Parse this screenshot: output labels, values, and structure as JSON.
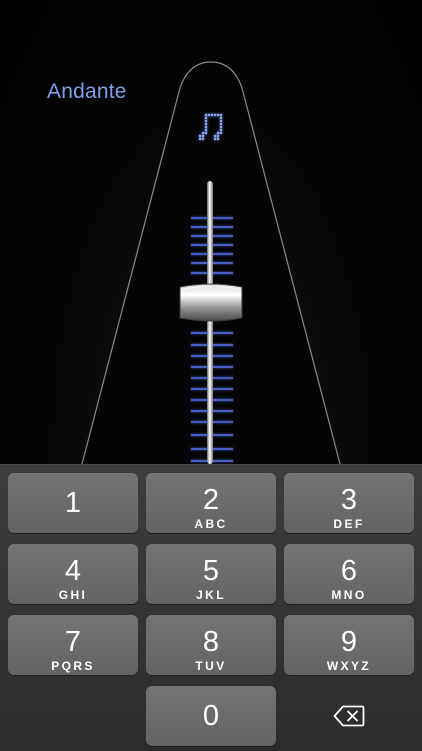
{
  "tempo": {
    "marking": "Andante"
  },
  "colors": {
    "accent_blue": "#7c9fe8",
    "led_blue": "#5b7fff",
    "key_bg": "#6c6c6c",
    "keypad_bg": "#353535"
  },
  "metronome": {
    "note_icon": "beamed-eighth-notes-icon",
    "slider_icon": "weight-slider-icon"
  },
  "keypad": {
    "keys": [
      {
        "digit": "1",
        "letters": ""
      },
      {
        "digit": "2",
        "letters": "ABC"
      },
      {
        "digit": "3",
        "letters": "DEF"
      },
      {
        "digit": "4",
        "letters": "GHI"
      },
      {
        "digit": "5",
        "letters": "JKL"
      },
      {
        "digit": "6",
        "letters": "MNO"
      },
      {
        "digit": "7",
        "letters": "PQRS"
      },
      {
        "digit": "8",
        "letters": "TUV"
      },
      {
        "digit": "9",
        "letters": "WXYZ"
      },
      {
        "digit": "0",
        "letters": ""
      }
    ],
    "delete_icon": "backspace-icon"
  }
}
